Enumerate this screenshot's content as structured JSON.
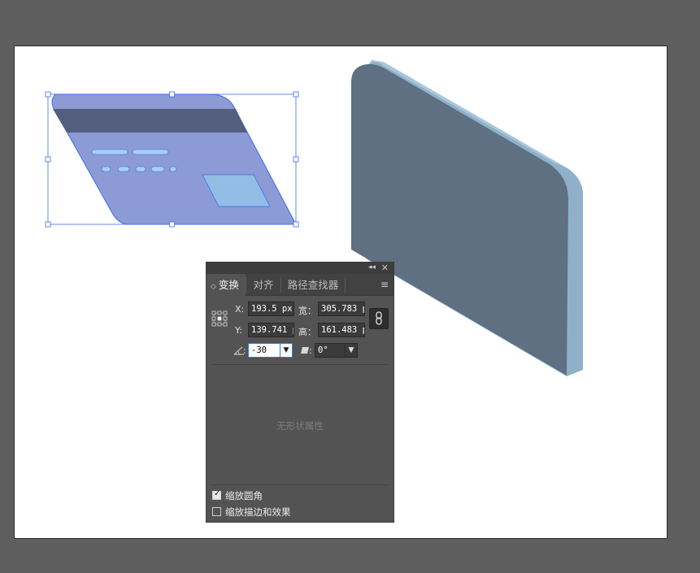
{
  "colors": {
    "workspace_bg": "#5e5e5e",
    "card_body": "#8c9ad6",
    "card_stripe": "#545f80",
    "card_chip": "#94bde6",
    "card_lines": "#a7cef5",
    "selection": "#3a6ee8",
    "slab_face": "#5e7081",
    "slab_side": "#8fb0c9"
  },
  "panel": {
    "tabs": [
      "变换",
      "对齐",
      "路径查找器"
    ],
    "x_label": "X:",
    "x_value": "193.5 px",
    "y_label": "Y:",
    "y_value": "139.741 p",
    "w_label": "宽：",
    "w_value": "305.783 p",
    "h_label": "高：",
    "h_value": "161.483 p",
    "rotate_icon": "rotate-angle-icon",
    "rotate_value": "-30",
    "shear_icon": "shear-icon",
    "shear_value": "0°",
    "no_shape": "无形状属性",
    "scale_corners": "缩放圆角",
    "scale_corners_checked": true,
    "scale_strokes": "缩放描边和效果",
    "scale_strokes_checked": false
  }
}
